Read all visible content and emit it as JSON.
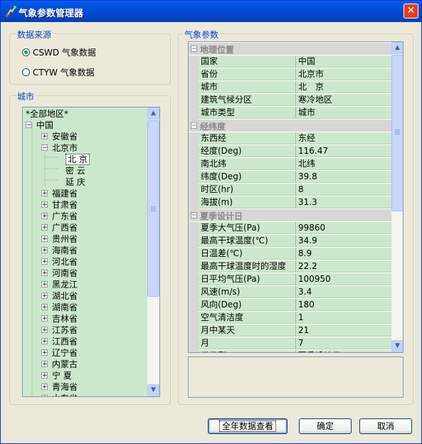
{
  "window": {
    "title": "气象参数管理器",
    "close_glyph": "✕"
  },
  "source": {
    "label": "数据来源",
    "options": [
      {
        "label": "CSWD 气象数据",
        "checked": true
      },
      {
        "label": "CTYW 气象数据",
        "checked": false
      }
    ]
  },
  "city": {
    "label": "城市",
    "tree": [
      {
        "label": "*全部地区*",
        "depth": 0,
        "expander": ""
      },
      {
        "label": "中国",
        "depth": 0,
        "expander": "−"
      },
      {
        "label": "安徽省",
        "depth": 1,
        "expander": "+"
      },
      {
        "label": "北京市",
        "depth": 1,
        "expander": "−"
      },
      {
        "label": "北 京",
        "depth": 2,
        "expander": "",
        "selected": true
      },
      {
        "label": "密 云",
        "depth": 2,
        "expander": ""
      },
      {
        "label": "延 庆",
        "depth": 2,
        "expander": ""
      },
      {
        "label": "福建省",
        "depth": 1,
        "expander": "+"
      },
      {
        "label": "甘肃省",
        "depth": 1,
        "expander": "+"
      },
      {
        "label": "广东省",
        "depth": 1,
        "expander": "+"
      },
      {
        "label": "广西省",
        "depth": 1,
        "expander": "+"
      },
      {
        "label": "贵州省",
        "depth": 1,
        "expander": "+"
      },
      {
        "label": "海南省",
        "depth": 1,
        "expander": "+"
      },
      {
        "label": "河北省",
        "depth": 1,
        "expander": "+"
      },
      {
        "label": "河南省",
        "depth": 1,
        "expander": "+"
      },
      {
        "label": "黑龙江",
        "depth": 1,
        "expander": "+"
      },
      {
        "label": "湖北省",
        "depth": 1,
        "expander": "+"
      },
      {
        "label": "湖南省",
        "depth": 1,
        "expander": "+"
      },
      {
        "label": "吉林省",
        "depth": 1,
        "expander": "+"
      },
      {
        "label": "江苏省",
        "depth": 1,
        "expander": "+"
      },
      {
        "label": "江西省",
        "depth": 1,
        "expander": "+"
      },
      {
        "label": "辽宁省",
        "depth": 1,
        "expander": "+"
      },
      {
        "label": "内蒙古",
        "depth": 1,
        "expander": "+"
      },
      {
        "label": "宁 夏",
        "depth": 1,
        "expander": "+"
      },
      {
        "label": "青海省",
        "depth": 1,
        "expander": "+"
      },
      {
        "label": "山东省",
        "depth": 1,
        "expander": "+"
      }
    ]
  },
  "params": {
    "label": "气象参数",
    "categories": [
      {
        "name": "地理位置",
        "expander": "−",
        "rows": [
          {
            "name": "国家",
            "value": "中国"
          },
          {
            "name": "省份",
            "value": "北京市"
          },
          {
            "name": "城市",
            "value": "北　京"
          },
          {
            "name": "建筑气候分区",
            "value": "寒冷地区"
          },
          {
            "name": "城市类型",
            "value": "城市"
          }
        ]
      },
      {
        "name": "经纬度",
        "expander": "−",
        "rows": [
          {
            "name": "东西经",
            "value": "东经"
          },
          {
            "name": "经度(Deg)",
            "value": "116.47"
          },
          {
            "name": "南北纬",
            "value": "北纬"
          },
          {
            "name": "纬度(Deg)",
            "value": "39.8"
          },
          {
            "name": "时区(hr)",
            "value": "8"
          },
          {
            "name": "海拔(m)",
            "value": "31.3"
          }
        ]
      },
      {
        "name": "夏季设计日",
        "expander": "−",
        "rows": [
          {
            "name": "夏季大气压(Pa)",
            "value": "99860"
          },
          {
            "name": "最高干球温度(℃)",
            "value": "34.9"
          },
          {
            "name": "日温差(℃)",
            "value": "8.9"
          },
          {
            "name": "最高干球温度时的湿度",
            "value": "22.2"
          },
          {
            "name": "日平均气压(Pa)",
            "value": "100950"
          },
          {
            "name": "风速(m/s)",
            "value": "3.4"
          },
          {
            "name": "风向(Deg)",
            "value": "180"
          },
          {
            "name": "空气清洁度",
            "value": "1"
          },
          {
            "name": "月中某天",
            "value": "21"
          },
          {
            "name": "月",
            "value": "7"
          },
          {
            "name": "日类型",
            "value": "夏季设计日"
          }
        ]
      }
    ]
  },
  "buttons": {
    "annual": "全年数据查看",
    "ok": "确定",
    "cancel": "取消"
  },
  "colors": {
    "title_bar": "#0055e5",
    "panel_bg": "#cce8cc",
    "group_label": "#0046d5"
  }
}
